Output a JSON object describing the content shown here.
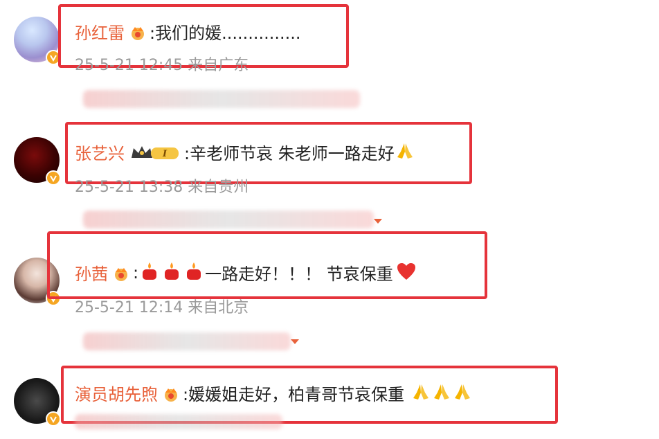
{
  "comments": [
    {
      "username": "孙红雷",
      "text": ":我们的媛...............",
      "time": "25-5-21 12:45",
      "location": "来自广东",
      "emoji_after": []
    },
    {
      "username": "张艺兴",
      "text": ":辛老师节哀 朱老师一路走好",
      "time": "25-5-21 13:38",
      "location": "来自贵州",
      "emoji_after": [
        "pray-emoji"
      ]
    },
    {
      "username": "孙茜",
      "text_prefix": ":",
      "text": "一路走好！！！ 节哀保重",
      "time": "25-5-21 12:14",
      "location": "来自北京",
      "emoji_before": [
        "candle-emoji",
        "candle-emoji",
        "candle-emoji"
      ],
      "emoji_after": [
        "heart-emoji"
      ]
    },
    {
      "username": "演员胡先煦",
      "text": ":媛媛姐走好，柏青哥节哀保重",
      "time": "",
      "location": "",
      "emoji_after": [
        "pray-emoji",
        "pray-emoji",
        "pray-emoji"
      ]
    }
  ],
  "colors": {
    "username": "#e8613a",
    "highlight_border": "#e5333b",
    "meta_text": "#9a9a9a",
    "verified_badge": "#f5a623"
  },
  "icons": [
    "crown-badge-icon",
    "vip-crown-level-icon",
    "verified-badge-icon",
    "expand-arrow-icon"
  ]
}
